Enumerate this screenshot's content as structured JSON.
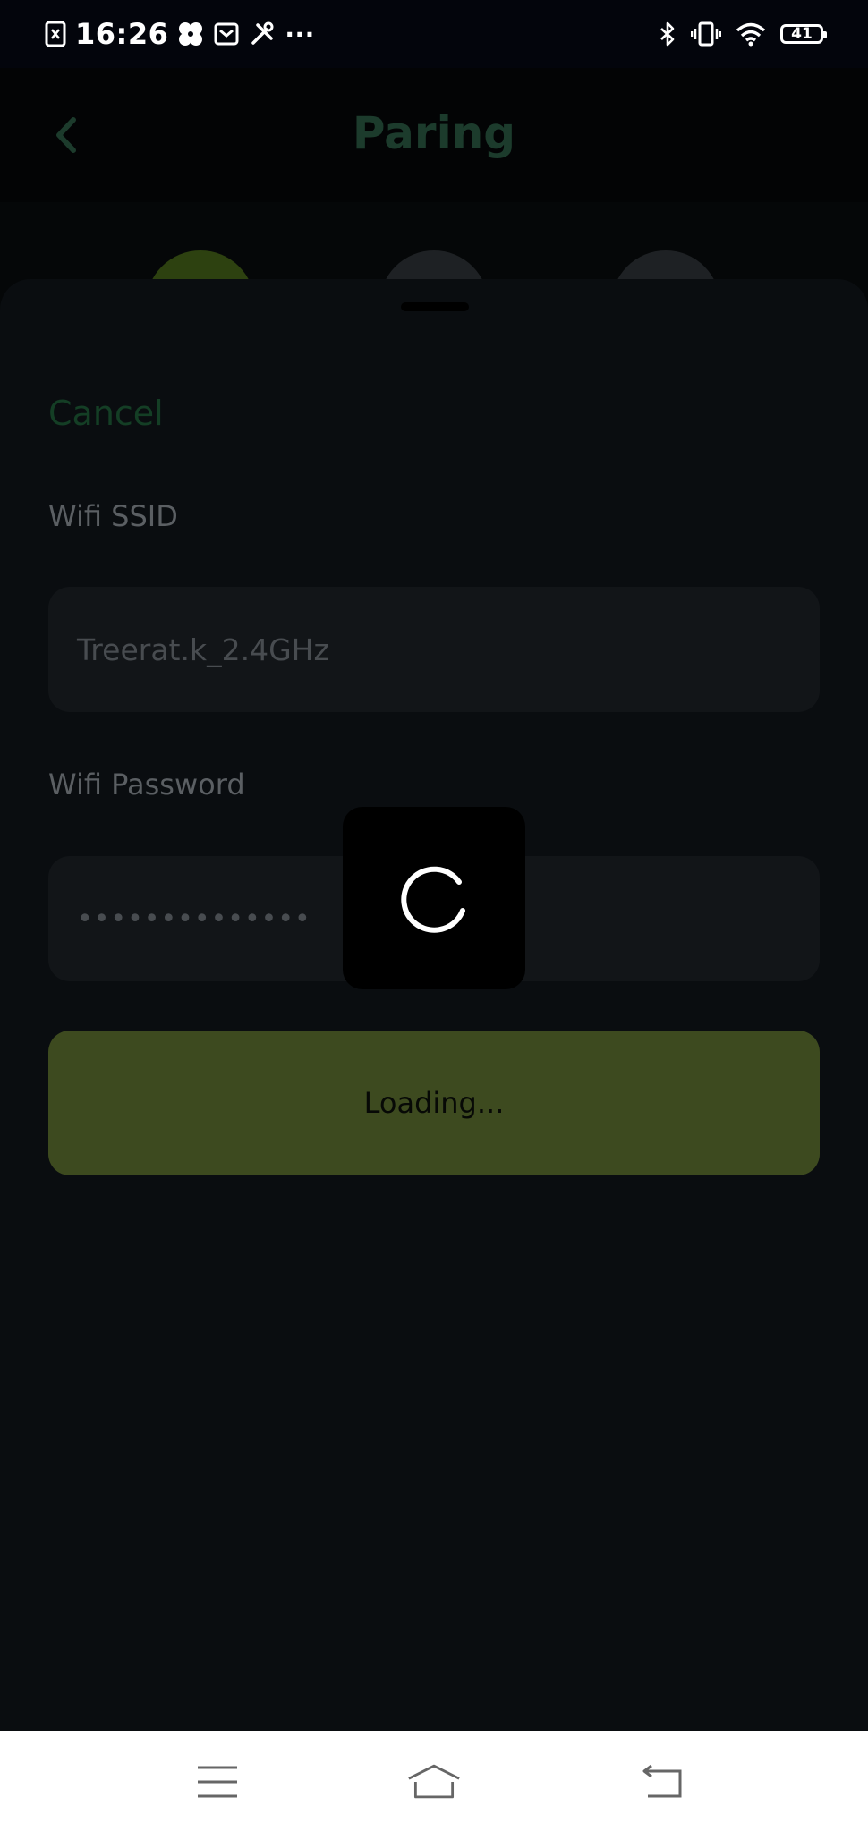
{
  "status_bar": {
    "time": "16:26",
    "more": "···",
    "battery_level": "41",
    "icons": [
      "sim-off-icon",
      "fan-icon",
      "mail-icon",
      "tools-icon",
      "bluetooth-icon",
      "vibrate-icon",
      "wifi-icon",
      "battery-icon"
    ]
  },
  "header": {
    "title": "Paring",
    "back_icon": "chevron-left-icon"
  },
  "steps": [
    {
      "state": "active",
      "color": "#2d4110"
    },
    {
      "state": "inactive",
      "color": "#1e2124"
    },
    {
      "state": "inactive",
      "color": "#1e2124"
    }
  ],
  "sheet": {
    "cancel_label": "Cancel",
    "ssid_label": "Wifi SSID",
    "ssid_value": "Treerat.k_2.4GHz",
    "password_label": "Wifi Password",
    "password_value": "••••••••••••••",
    "submit_label": "Loading..."
  },
  "loader": {
    "icon": "spinner-icon"
  },
  "nav_bar": {
    "icons": [
      "menu-icon",
      "home-icon",
      "back-icon"
    ]
  },
  "colors": {
    "accent_green": "#3d4a1f",
    "title_green": "#1c3b2c",
    "background": "#0a0d10"
  }
}
